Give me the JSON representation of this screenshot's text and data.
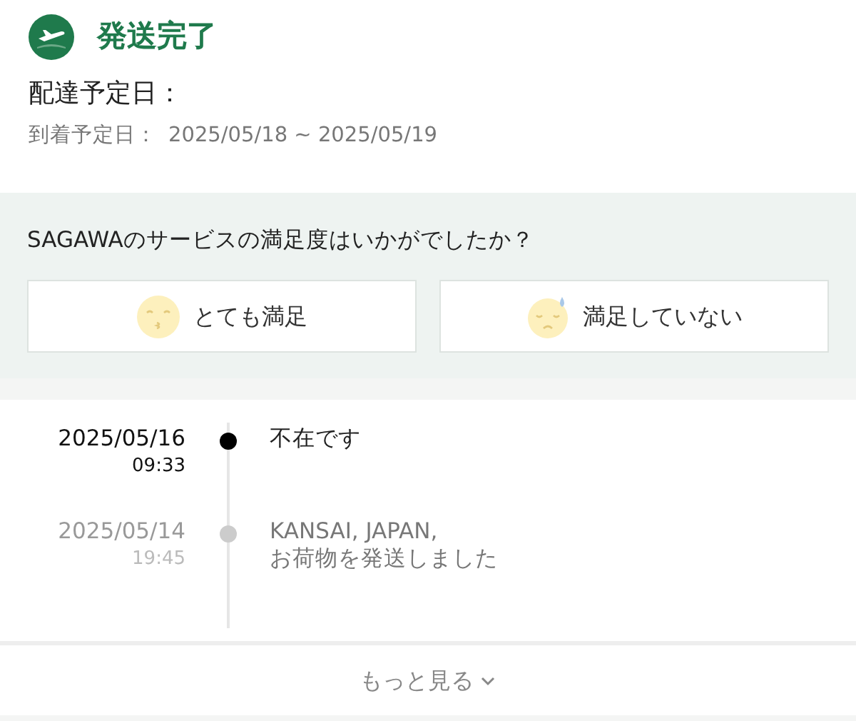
{
  "status": {
    "title": "発送完了"
  },
  "delivery": {
    "label": "配達予定日：",
    "arrival_label": "到着予定日：",
    "arrival_range": "2025/05/18 ~ 2025/05/19"
  },
  "survey": {
    "question": "SAGAWAのサービスの満足度はいかがでしたか？",
    "options": [
      {
        "label": "とても満足",
        "kind": "happy"
      },
      {
        "label": "満足していない",
        "kind": "unhappy"
      }
    ]
  },
  "timeline": [
    {
      "date": "2025/05/16",
      "time": "09:33",
      "lines": [
        "不在です"
      ],
      "current": true
    },
    {
      "date": "2025/05/14",
      "time": "19:45",
      "lines": [
        "KANSAI, JAPAN,",
        "お荷物を発送しました"
      ],
      "current": false
    }
  ],
  "more": {
    "label": "もっと見る"
  }
}
